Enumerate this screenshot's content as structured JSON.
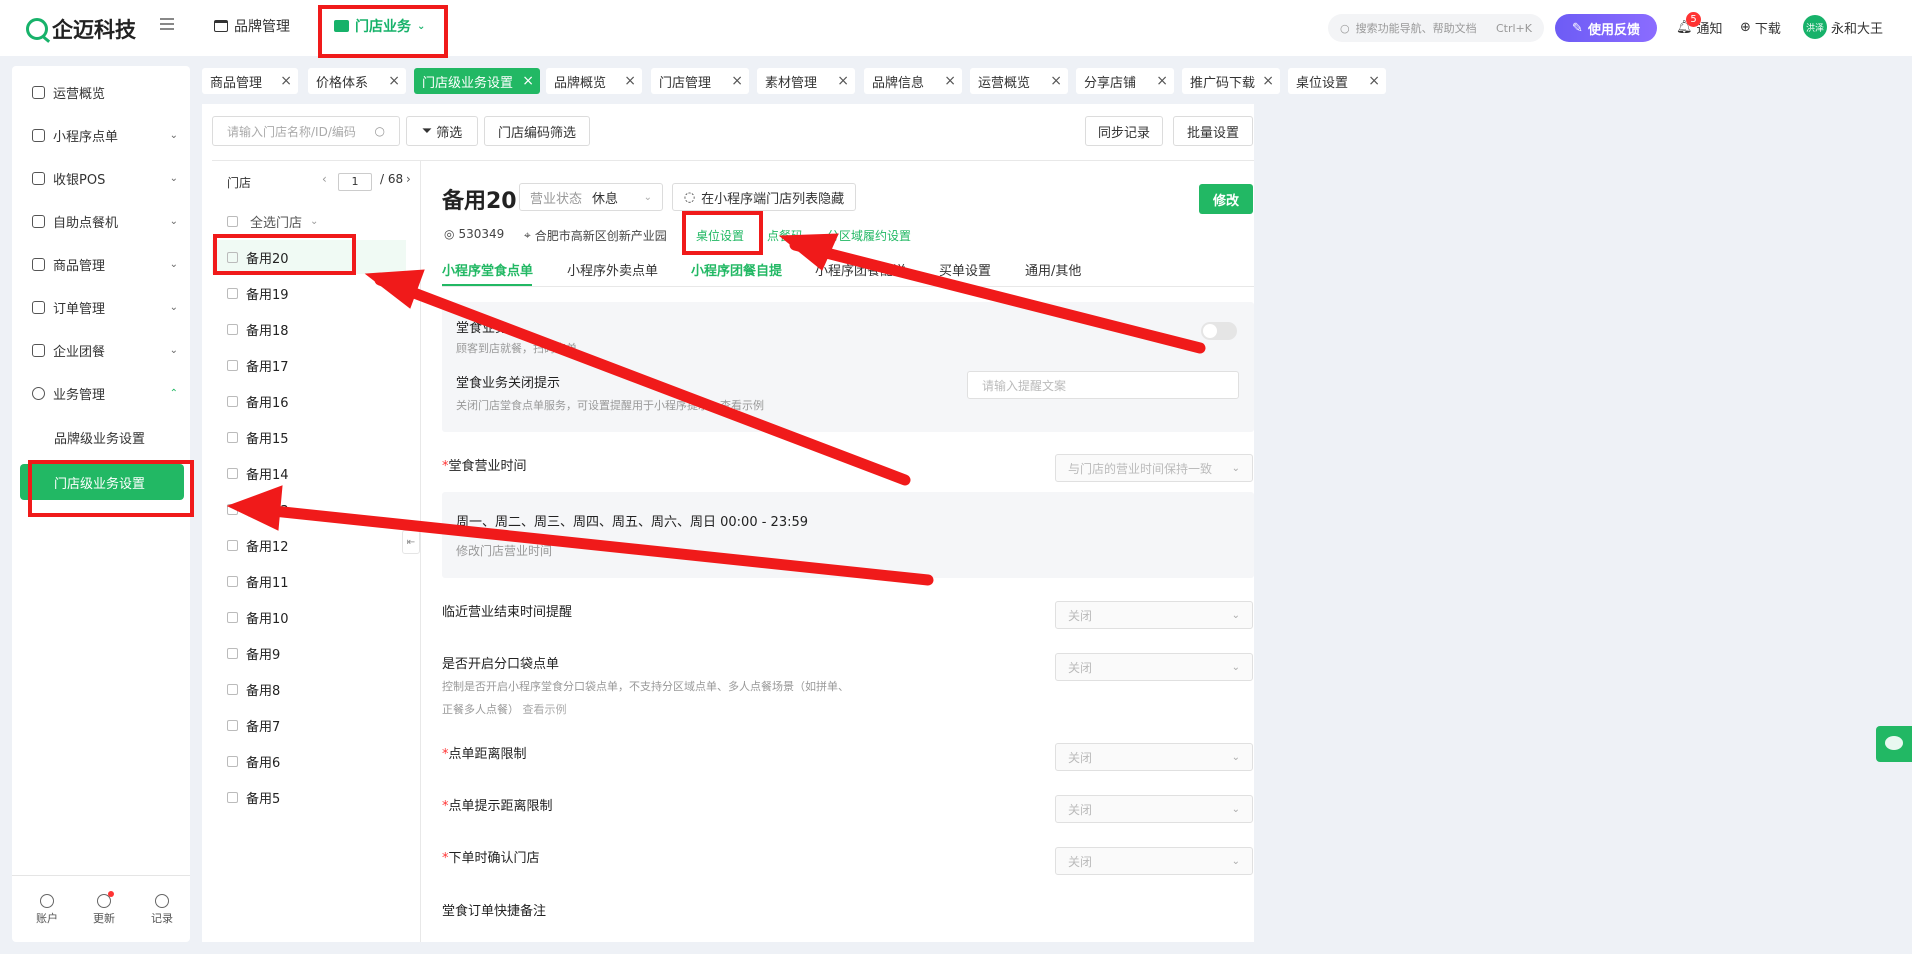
{
  "brand": {
    "name": "企迈科技",
    "accent": "#22b864"
  },
  "top_nav": {
    "items": [
      {
        "label": "品牌管理",
        "icon": "store-icon"
      },
      {
        "label": "门店业务",
        "icon": "shop-icon",
        "active": true
      }
    ],
    "search_placeholder": "搜索功能导航、帮助文档",
    "search_shortcut": "Ctrl+K",
    "feedback_label": "使用反馈",
    "notify_label": "通知",
    "notify_count": "5",
    "download_label": "下载",
    "avatar_text": "洪泽",
    "user_name": "永和大王"
  },
  "sidebar": {
    "items": [
      {
        "label": "运营概览"
      },
      {
        "label": "小程序点单"
      },
      {
        "label": "收银POS"
      },
      {
        "label": "自助点餐机"
      },
      {
        "label": "商品管理"
      },
      {
        "label": "订单管理"
      },
      {
        "label": "企业团餐"
      },
      {
        "label": "业务管理"
      }
    ],
    "sub_items": [
      {
        "label": "品牌级业务设置"
      },
      {
        "label": "门店级业务设置",
        "active": true
      }
    ],
    "bottom": [
      {
        "label": "账户"
      },
      {
        "label": "更新"
      },
      {
        "label": "记录"
      }
    ]
  },
  "tabs": [
    {
      "label": "商品管理"
    },
    {
      "label": "价格体系"
    },
    {
      "label": "门店级业务设置",
      "active": true
    },
    {
      "label": "品牌概览"
    },
    {
      "label": "门店管理"
    },
    {
      "label": "素材管理"
    },
    {
      "label": "品牌信息"
    },
    {
      "label": "运营概览"
    },
    {
      "label": "分享店铺"
    },
    {
      "label": "推广码下载"
    },
    {
      "label": "桌位设置"
    }
  ],
  "toolbar": {
    "search_placeholder": "请输入门店名称/ID/编码",
    "filter_label": "筛选",
    "code_filter_label": "门店编码筛选",
    "sync_label": "同步记录",
    "batch_label": "批量设置"
  },
  "store_list": {
    "header": "门店",
    "page_current": "1",
    "page_total": "/ 68",
    "select_all": "全选门店",
    "stores": [
      "备用20",
      "备用19",
      "备用18",
      "备用17",
      "备用16",
      "备用15",
      "备用14",
      "备用13",
      "备用12",
      "备用11",
      "备用10",
      "备用9",
      "备用8",
      "备用7",
      "备用6",
      "备用5"
    ]
  },
  "detail": {
    "title": "备用20",
    "status_label": "营业状态",
    "status_value": "休息",
    "hide_label": "在小程序端门店列表隐藏",
    "edit_label": "修改",
    "store_id": "530349",
    "address": "合肥市高新区创新产业园",
    "links": [
      "桌位设置",
      "点餐码",
      "分区域履约设置"
    ],
    "subtabs": [
      "小程序堂食点单",
      "小程序外卖点单",
      "小程序团餐自提",
      "小程序团餐配送",
      "买单设置",
      "通用/其他"
    ],
    "dine_in_label": "堂食业务",
    "dine_in_hint": "顾客到店就餐，扫码点单",
    "close_tip_label": "堂食业务关闭提示",
    "close_tip_hint": "关闭门店堂食点单服务，可设置提醒用于小程序提示，查看示例",
    "close_tip_placeholder": "请输入提醒文案",
    "hours_label": "堂食营业时间",
    "hours_select": "与门店的营业时间保持一致",
    "hours_value": "周一、周二、周三、周四、周五、周六、周日  00:00 - 23:59",
    "hours_edit": "修改门店营业时间",
    "end_remind_label": "临近营业结束时间提醒",
    "end_remind_value": "关闭",
    "bag_label": "是否开启分口袋点单",
    "bag_hint_1": "控制是否开启小程序堂食分口袋点单，不支持分区域点单、多人点餐场景（如拼单、",
    "bag_hint_2": "正餐多人点餐）",
    "bag_hint_link": "查看示例",
    "bag_value": "关闭",
    "distance_label": "点单距离限制",
    "distance_value": "关闭",
    "distance_tip_label": "点单提示距离限制",
    "distance_tip_value": "关闭",
    "confirm_label": "下单时确认门店",
    "confirm_value": "关闭",
    "remark_label": "堂食订单快捷备注"
  }
}
